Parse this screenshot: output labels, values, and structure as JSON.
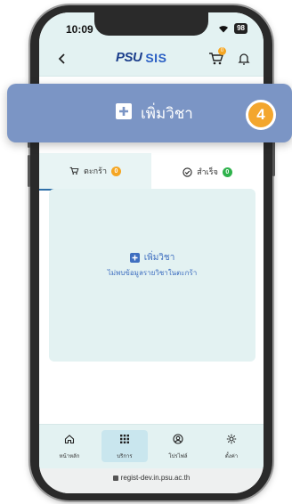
{
  "status_bar": {
    "time": "10:09",
    "battery": "98"
  },
  "header": {
    "logo_left": "PSU",
    "logo_right": "SIS",
    "cart_count": "0"
  },
  "callout": {
    "label": "เพิ่มวิชา",
    "step": "4"
  },
  "tabs": [
    {
      "label": "ตะกร้า",
      "count": "0"
    },
    {
      "label": "สำเร็จ",
      "count": "0"
    }
  ],
  "panel": {
    "add_label": "เพิ่มวิชา",
    "empty_message": "ไม่พบข้อมูลรายวิชาในตะกร้า"
  },
  "bottom_nav": [
    {
      "label": "หน้าหลัก",
      "icon": "home-icon"
    },
    {
      "label": "บริการ",
      "icon": "grid-icon"
    },
    {
      "label": "โปรไฟล์",
      "icon": "profile-icon"
    },
    {
      "label": "ตั้งค่า",
      "icon": "gear-icon"
    }
  ],
  "url": "regist-dev.in.psu.ac.th",
  "colors": {
    "header_bg": "#e3f2f2",
    "callout_bg": "#7b95c5",
    "step_badge": "#f3a62e",
    "accent_blue": "#3f6fc0",
    "badge_green": "#2fb24c"
  }
}
